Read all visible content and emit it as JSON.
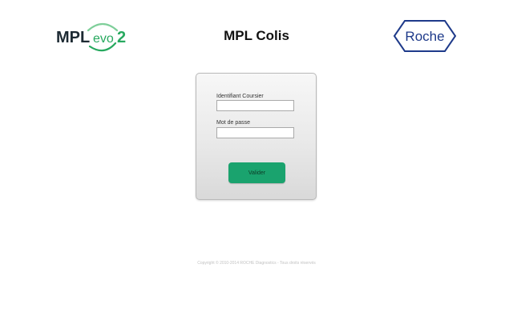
{
  "header": {
    "left_logo": {
      "prefix": "MPL",
      "middle": "evo",
      "suffix": "2",
      "colors": {
        "prefix": "#1d2a33",
        "accent": "#27a95f",
        "swoosh_dark": "#1d6f3f"
      }
    },
    "title": "MPL Colis",
    "right_logo": {
      "text": "Roche",
      "color": "#1e3a8a"
    }
  },
  "login": {
    "courier_label": "Identifiant Coursier",
    "courier_value": "",
    "password_label": "Mot de passe",
    "password_value": "",
    "submit_label": "Valider",
    "submit_color": "#1aa36e"
  },
  "footer": {
    "copyright": "Copyright © 2010-2014 ROCHE Diagnostics - Tous droits réservés"
  }
}
